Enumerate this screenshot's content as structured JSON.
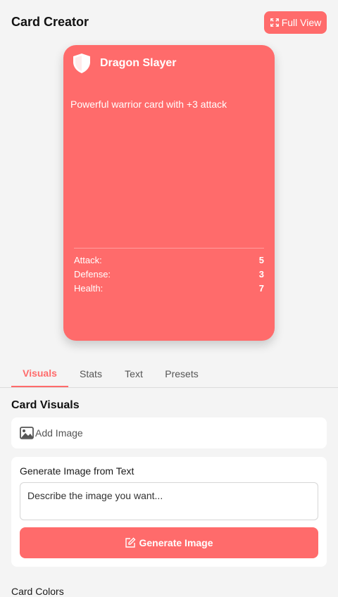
{
  "header": {
    "title": "Card Creator",
    "full_view_label": "Full View",
    "full_view_icon": "expand-icon"
  },
  "card": {
    "name": "Dragon Slayer",
    "icon": "shield-icon",
    "description": "Powerful warrior card with +3 attack",
    "color": "#ff6b6b",
    "stats": [
      {
        "label": "Attack:",
        "value": "5"
      },
      {
        "label": "Defense:",
        "value": "3"
      },
      {
        "label": "Health:",
        "value": "7"
      }
    ]
  },
  "tabs": [
    {
      "label": "Visuals",
      "active": true
    },
    {
      "label": "Stats",
      "active": false
    },
    {
      "label": "Text",
      "active": false
    },
    {
      "label": "Presets",
      "active": false
    }
  ],
  "visuals": {
    "section_title": "Card Visuals",
    "add_image_label": "Add Image",
    "generate": {
      "label": "Generate Image from Text",
      "placeholder": "Describe the image you want...",
      "button_label": "Generate Image"
    },
    "colors_title": "Card Colors"
  },
  "colors": {
    "accent": "#ff6b6b",
    "background": "#f4f4f4"
  }
}
